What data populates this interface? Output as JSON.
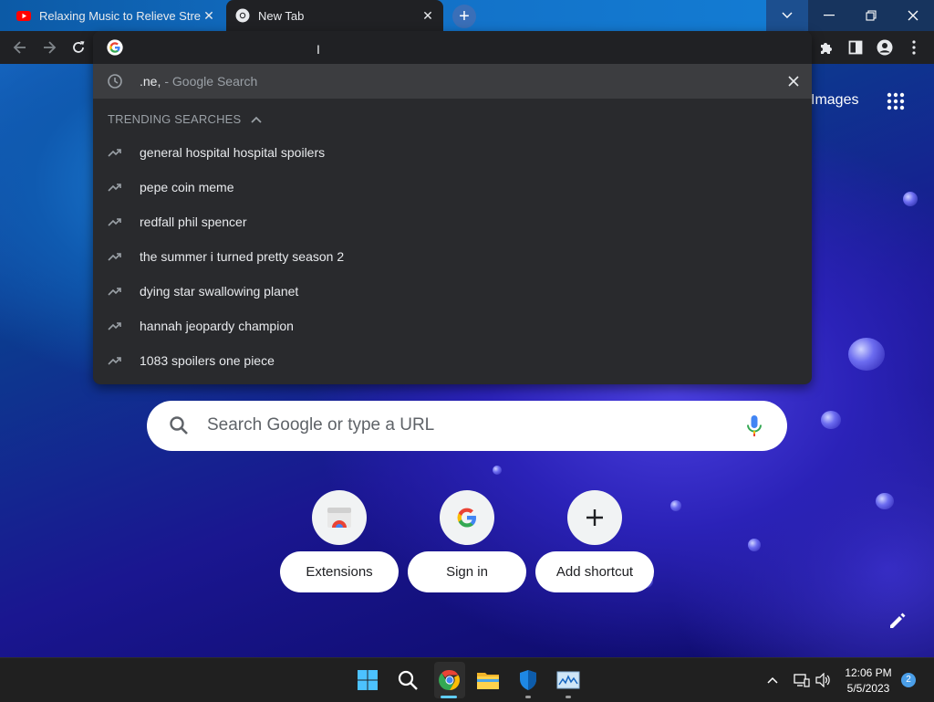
{
  "tabs": [
    {
      "title": "Relaxing Music to Relieve Stress,",
      "favicon": "youtube-icon"
    },
    {
      "title": "New Tab",
      "favicon": "chrome-icon"
    }
  ],
  "omnibox": {
    "history_query": ".ne,",
    "history_suffix": "- Google Search",
    "trending_header": "TRENDING SEARCHES",
    "trending": [
      "general hospital hospital spoilers",
      "pepe coin meme",
      "redfall phil spencer",
      "the summer i turned pretty season 2",
      "dying star swallowing planet",
      "hannah jeopardy champion",
      "1083 spoilers one piece"
    ]
  },
  "ntp": {
    "images_link": "Images",
    "search_placeholder": "Search Google or type a URL",
    "shortcuts": [
      {
        "label": "Extensions",
        "icon": "chrome-web-store-icon"
      },
      {
        "label": "Sign in",
        "icon": "google-g-icon"
      },
      {
        "label": "Add shortcut",
        "icon": "plus-icon"
      }
    ]
  },
  "taskbar": {
    "time": "12:06 PM",
    "date": "5/5/2023",
    "notification_count": "2"
  },
  "colors": {
    "toolbar": "#202124",
    "popup": "#292a2d",
    "selected_row": "#3c3d40",
    "accent": "#60cdff"
  }
}
